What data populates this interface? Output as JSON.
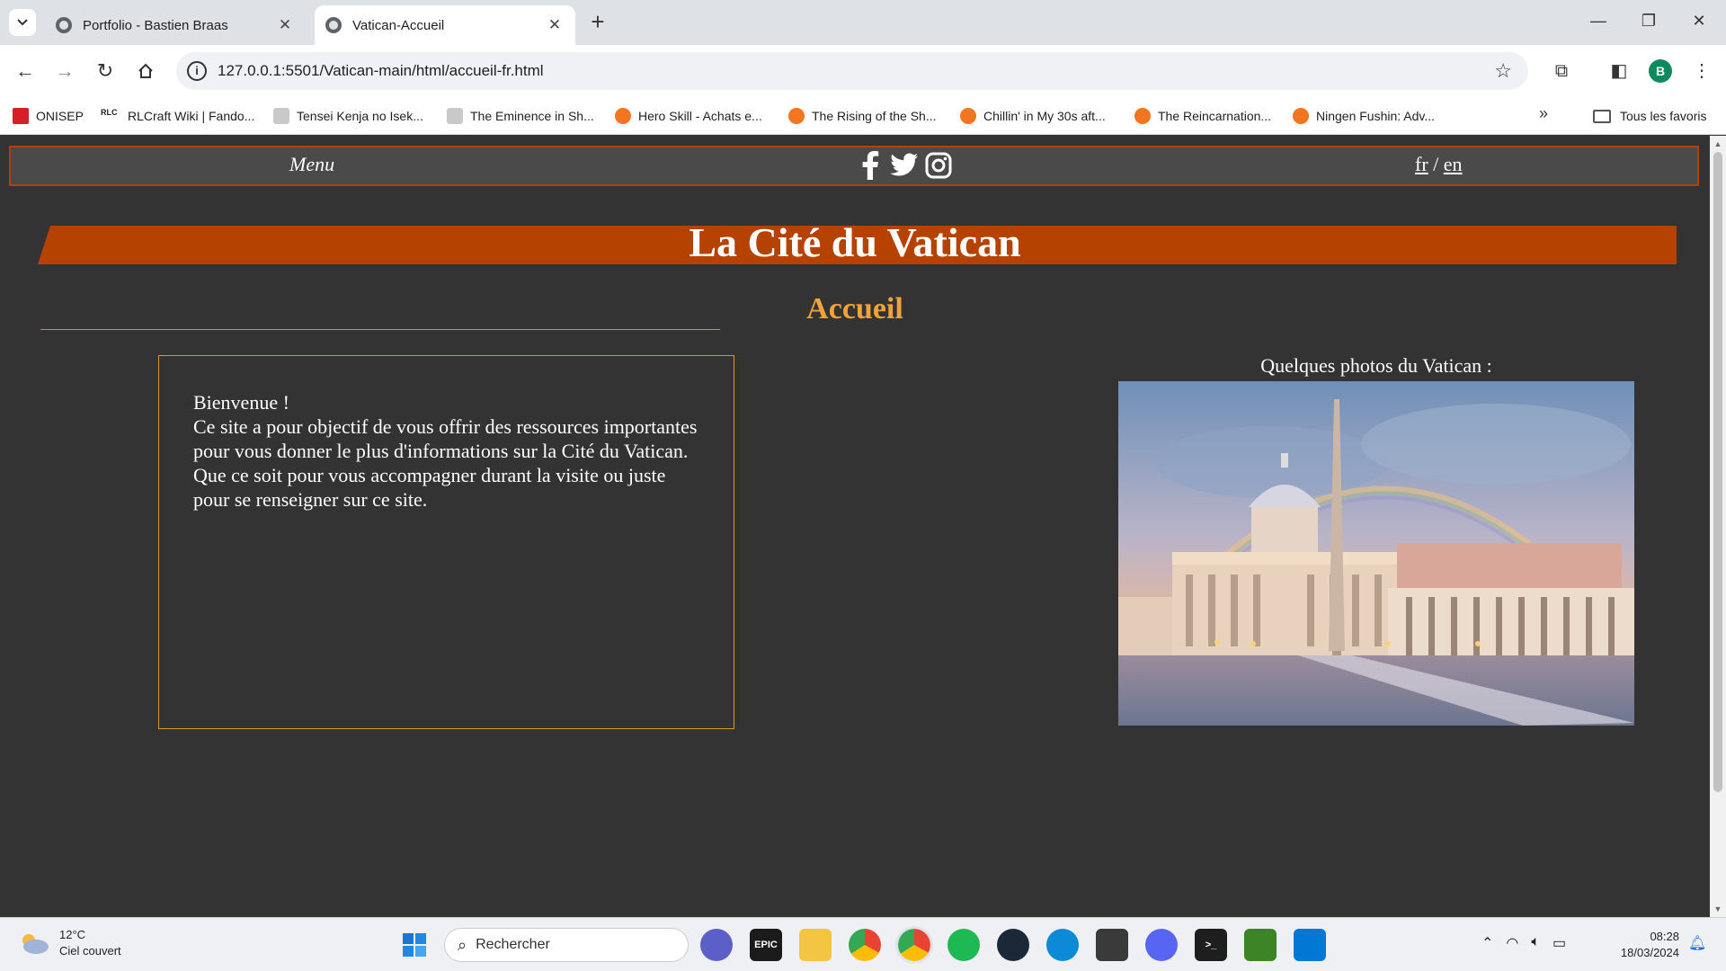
{
  "browser": {
    "tabs": [
      {
        "title": "Portfolio - Bastien Braas",
        "active": false
      },
      {
        "title": "Vatican-Accueil",
        "active": true
      }
    ],
    "url": "127.0.0.1:5501/Vatican-main/html/accueil-fr.html",
    "profile_initial": "B",
    "bookmarks": [
      {
        "label": "ONISEP",
        "icon": "onisep-icon"
      },
      {
        "label": "RLCraft Wiki | Fando...",
        "icon": "rlc-icon"
      },
      {
        "label": "Tensei Kenja no Isek...",
        "icon": "manga-icon"
      },
      {
        "label": "The Eminence in Sh...",
        "icon": "manga-icon"
      },
      {
        "label": "Hero Skill - Achats e...",
        "icon": "crunchyroll-icon"
      },
      {
        "label": "The Rising of the Sh...",
        "icon": "crunchyroll-icon"
      },
      {
        "label": "Chillin' in My 30s aft...",
        "icon": "crunchyroll-icon"
      },
      {
        "label": "The Reincarnation...",
        "icon": "crunchyroll-icon"
      },
      {
        "label": "Ningen Fushin: Adv...",
        "icon": "crunchyroll-icon"
      }
    ],
    "all_bookmarks_label": "Tous les favoris"
  },
  "site": {
    "nav": {
      "menu_label": "Menu",
      "social_icons": [
        "facebook-icon",
        "twitter-icon",
        "instagram-icon"
      ],
      "lang_fr": "fr",
      "lang_sep": " / ",
      "lang_en": "en"
    },
    "title": "La Cité du Vatican",
    "subtitle": "Accueil",
    "welcome": {
      "line1": "Bienvenue !",
      "line2": "Ce site a pour objectif de vous offrir des ressources importantes pour vous donner le plus d'informations sur la Cité du Vatican.",
      "line3": "Que ce soit pour vous accompagner durant la visite ou juste pour se renseigner sur ce site."
    },
    "photos_label": "Quelques photos du Vatican :",
    "colors": {
      "background": "#333333",
      "accent_orange": "#b64202",
      "subtitle_gold": "#f0a33a",
      "border_gold": "#d99a2b"
    }
  },
  "taskbar": {
    "weather_temp": "12°C",
    "weather_desc": "Ciel couvert",
    "search_placeholder": "Rechercher",
    "time": "08:28",
    "date": "18/03/2024"
  }
}
